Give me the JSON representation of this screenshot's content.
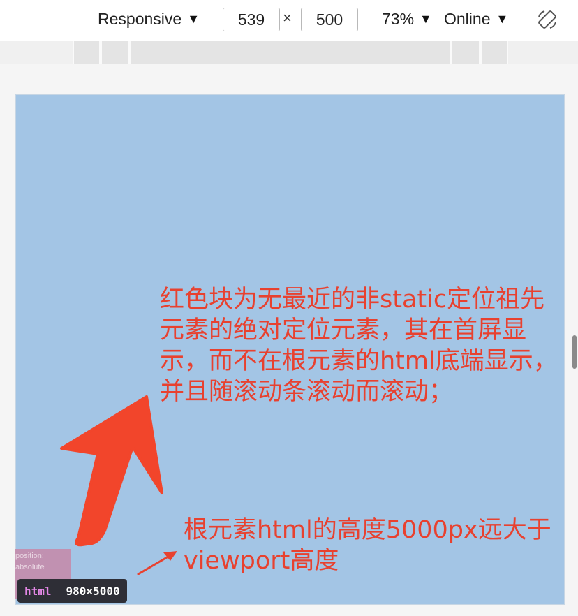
{
  "toolbar": {
    "device_label": "Responsive",
    "width_value": "539",
    "times_symbol": "×",
    "height_value": "500",
    "zoom_label": "73%",
    "network_label": "Online",
    "caret": "▼",
    "rotate_icon": "rotate-icon"
  },
  "annotations": {
    "main": "红色块为无最近的非static定位祖先元素的绝对定位元素，其在首屏显示，而不在根元素的html底端显示，并且随滚动条滚动而滚动；",
    "secondary": "根元素html的高度5000px远大于viewport高度"
  },
  "abs_box": {
    "line1": "position:",
    "line2": "absolute"
  },
  "badge": {
    "tag": "html",
    "size": "980×5000"
  },
  "colors": {
    "viewport_bg": "#a3c5e5",
    "annotation_red": "#e8412f",
    "arrow_red": "#f2452b",
    "abs_box": "#c48bab"
  }
}
